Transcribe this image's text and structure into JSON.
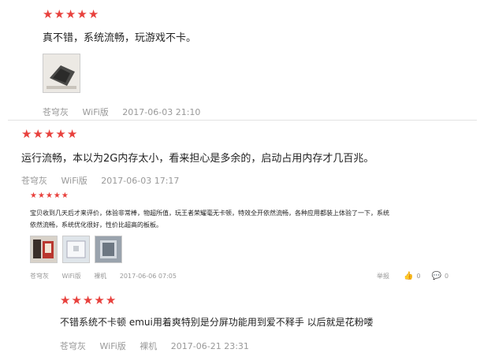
{
  "reviews": [
    {
      "rating": 5,
      "text": "真不错，系统流畅，玩游戏不卡。",
      "user": "苍穹灰",
      "version": "WiFi版",
      "date": "2017-06-03 21:10",
      "images": [
        "photo-1"
      ]
    },
    {
      "rating": 5,
      "text": "运行流畅，本以为2G内存太小，看来担心是多余的，启动占用内存才几百兆。",
      "user": "苍穹灰",
      "version": "WiFi版",
      "date": "2017-06-03 17:17"
    },
    {
      "rating": 5,
      "text_line1": "宝贝收到几天后才来评价，体验非常棒，物超所值，玩王者荣耀毫无卡顿，特效全开依然流畅，各种应用都装上体验了一下，系统",
      "text_line2": "依然流畅，系统优化很好，性价比超高的板板。",
      "user": "苍穹灰",
      "version": "WiFi版",
      "color": "裸机",
      "date": "2017-06-06 07:05",
      "report_label": "举报",
      "likes": "0",
      "comments": "0",
      "images": [
        "photo-1",
        "photo-2",
        "photo-3"
      ]
    },
    {
      "rating": 5,
      "text": "不错系统不卡顿 emui用着爽特别是分屏功能用到爱不释手 以后就是花粉喽",
      "user": "苍穹灰",
      "version": "WiFi版",
      "color": "裸机",
      "date": "2017-06-21 23:31"
    }
  ],
  "icons": {
    "star": "star-icon",
    "like": "thumbs-up-icon",
    "comment": "comment-icon"
  },
  "colors": {
    "star": "#e8413d",
    "meta": "#999999",
    "text": "#222222"
  }
}
